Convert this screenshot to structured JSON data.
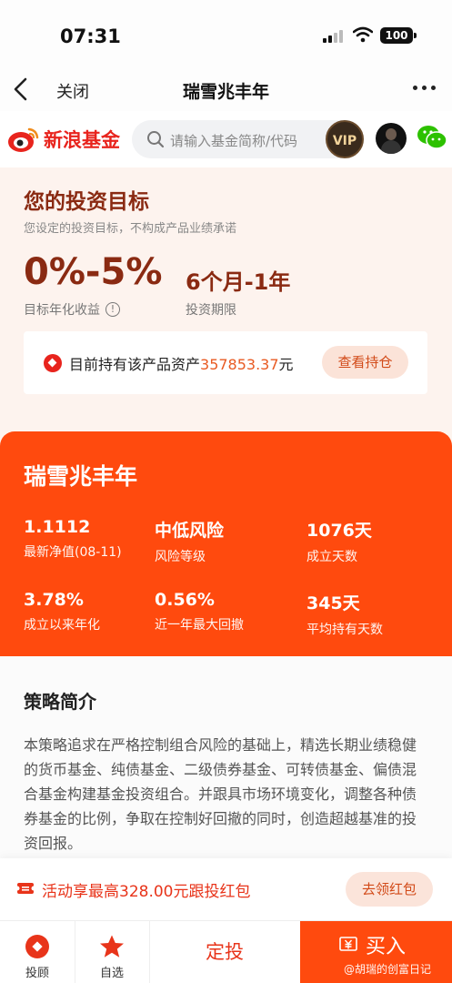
{
  "status_bar": {
    "time": "07:31",
    "battery": "100"
  },
  "navbar": {
    "close_label": "关闭",
    "title": "瑞雪兆丰年"
  },
  "brand": {
    "name": "新浪基金"
  },
  "search": {
    "placeholder": "请输入基金简称/代码"
  },
  "vip_label": "VIP",
  "goal": {
    "heading": "您的投资目标",
    "subtitle": "您设定的投资目标，不构成产品业绩承诺",
    "return_value": "0%-5%",
    "return_label": "目标年化收益",
    "period_value": "6个月-1年",
    "period_label": "投资期限",
    "holding_prefix": "目前持有该产品资产",
    "holding_amount": "357853.37",
    "holding_suffix": "元",
    "view_button": "查看持仓"
  },
  "fund": {
    "name": "瑞雪兆丰年",
    "stats": [
      {
        "value": "1.1112",
        "label": "最新净值(08-11)"
      },
      {
        "value": "中低风险",
        "label": "风险等级"
      },
      {
        "value": "1076天",
        "label": "成立天数"
      },
      {
        "value": "3.78%",
        "label": "成立以来年化"
      },
      {
        "value": "0.56%",
        "label": "近一年最大回撤"
      },
      {
        "value": "345天",
        "label": "平均持有天数"
      }
    ]
  },
  "strategy": {
    "heading": "策略简介",
    "body": "本策略追求在严格控制组合风险的基础上，精选长期业绩稳健的货币基金、纯债基金、二级债券基金、可转债基金、偏债混合基金构建基金投资组合。并跟具市场环境变化，调整各种债券基金的比例，争取在控制好回撤的同时，创造超越基准的投资回报。"
  },
  "promo": {
    "text": "活动享最高328.00元跟投红包",
    "button": "去领红包"
  },
  "bottom": {
    "advisor": "投顾",
    "watchlist": "自选",
    "auto_invest": "定投",
    "buy": "买入"
  },
  "watermark": "@胡瑞的创富日记",
  "colors": {
    "accent": "#ff4a0e",
    "brand_red": "#e8241d",
    "goal_text": "#8a2a12"
  }
}
